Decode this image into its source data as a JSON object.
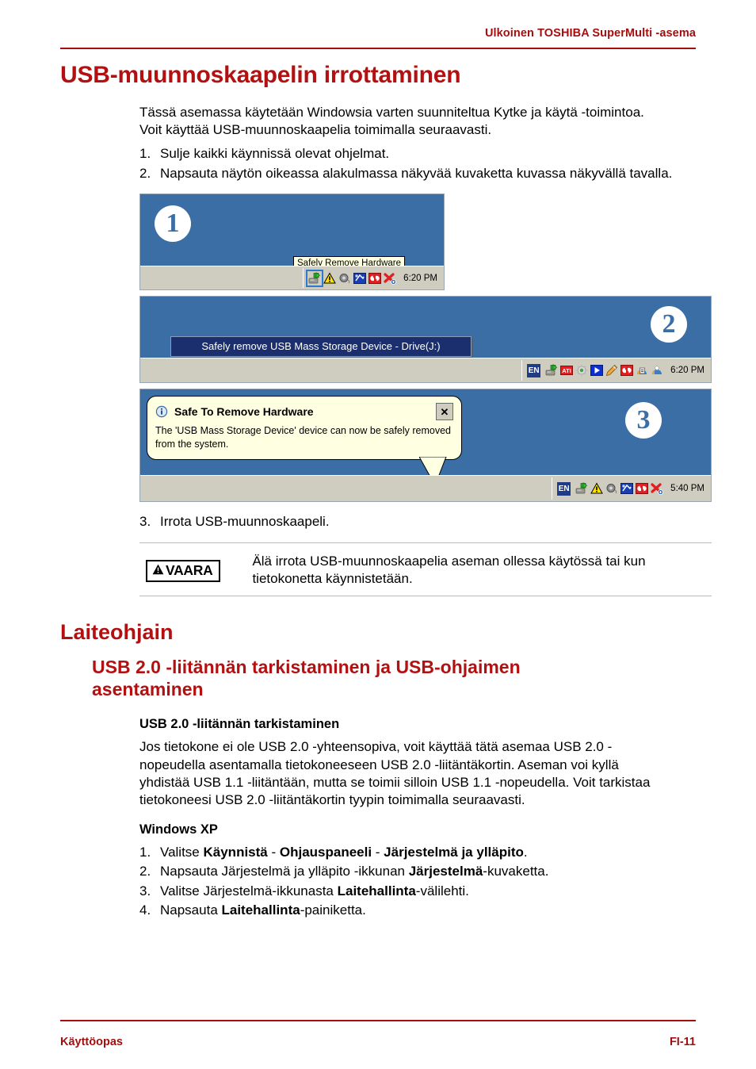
{
  "header": {
    "title": "Ulkoinen TOSHIBA SuperMulti -asema"
  },
  "footer": {
    "left": "Käyttöopas",
    "right": "FI-11"
  },
  "colors": {
    "accent_red": "#b31111",
    "header_red": "#a50e0e",
    "desktop_blue": "#3a6ea5",
    "taskbar_grey": "#cfccc0",
    "tooltip_yellow": "#ffffe1",
    "tooltip_blue": "#1b2f6e",
    "selection_blue": "#2e7ad1"
  },
  "section1": {
    "heading": "USB-muunnoskaapelin irrottaminen",
    "intro": "Tässä asemassa käytetään Windowsia varten suunniteltua Kytke ja käytä -toimintoa. Voit käyttää USB-muunnoskaapelia toimimalla seuraavasti.",
    "steps": [
      {
        "num": "1.",
        "text": "Sulje kaikki käynnissä olevat ohjelmat."
      },
      {
        "num": "2.",
        "text": "Napsauta näytön oikeassa alakulmassa näkyvää kuvaketta kuvassa näkyvällä tavalla."
      }
    ],
    "step3": {
      "num": "3.",
      "text": "Irrota USB-muunnoskaapeli."
    }
  },
  "figures": {
    "panel1": {
      "badge": "1",
      "tooltip": "Safely Remove Hardware",
      "time": "6:20 PM",
      "tray_icons": [
        "safely-remove-hardware-icon",
        "warning-icon",
        "volume-icon",
        "network-icon",
        "antivirus-icon",
        "disconnected-network-icon"
      ]
    },
    "panel2": {
      "badge": "2",
      "tooltip": "Safely remove USB Mass Storage Device - Drive(J:)",
      "language": "EN",
      "time": "6:20 PM",
      "tray_icons": [
        "safely-remove-hardware-icon",
        "ati-icon",
        "gear-icon",
        "media-player-icon",
        "pencil-icon",
        "antivirus-icon",
        "printer-icon",
        "windows-update-icon"
      ]
    },
    "panel3": {
      "badge": "3",
      "balloon_title": "Safe To Remove Hardware",
      "balloon_body": "The 'USB Mass Storage Device' device can now be safely removed from the system.",
      "balloon_close": "✕",
      "language": "EN",
      "time": "5:40 PM",
      "tray_icons": [
        "safely-remove-hardware-icon",
        "warning-icon",
        "volume-icon",
        "network-icon",
        "antivirus-icon",
        "disconnected-network-icon"
      ]
    }
  },
  "warning": {
    "badge": "VAARA",
    "text": "Älä irrota USB-muunnoskaapelia aseman ollessa käytössä tai kun tietokonetta käynnistetään."
  },
  "section2": {
    "heading": "Laiteohjain",
    "subheading": "USB 2.0 -liitännän tarkistaminen ja USB-ohjaimen asentaminen",
    "sub_subheading": "USB 2.0 -liitännän tarkistaminen",
    "paragraph": "Jos tietokone ei ole USB 2.0 -yhteensopiva, voit käyttää tätä asemaa USB 2.0 -nopeudella asentamalla tietokoneeseen USB 2.0 -liitäntäkortin. Aseman voi kyllä yhdistää USB 1.1 -liitäntään, mutta se toimii silloin USB 1.1 -nopeudella. Voit tarkistaa tietokoneesi USB 2.0 -liitäntäkortin tyypin toimimalla seuraavasti.",
    "os_heading": "Windows XP",
    "steps": [
      {
        "num": "1.",
        "parts": [
          {
            "t": "Valitse ",
            "b": false
          },
          {
            "t": "Käynnistä",
            "b": true
          },
          {
            "t": " - ",
            "b": false
          },
          {
            "t": "Ohjauspaneeli",
            "b": true
          },
          {
            "t": " - ",
            "b": false
          },
          {
            "t": "Järjestelmä ja ylläpito",
            "b": true
          },
          {
            "t": ".",
            "b": false
          }
        ]
      },
      {
        "num": "2.",
        "parts": [
          {
            "t": "Napsauta Järjestelmä ja ylläpito -ikkunan ",
            "b": false
          },
          {
            "t": "Järjestelmä",
            "b": true
          },
          {
            "t": "-kuvaketta.",
            "b": false
          }
        ]
      },
      {
        "num": "3.",
        "parts": [
          {
            "t": "Valitse Järjestelmä-ikkunasta ",
            "b": false
          },
          {
            "t": "Laitehallinta",
            "b": true
          },
          {
            "t": "-välilehti.",
            "b": false
          }
        ]
      },
      {
        "num": "4.",
        "parts": [
          {
            "t": "Napsauta ",
            "b": false
          },
          {
            "t": "Laitehallinta",
            "b": true
          },
          {
            "t": "-painiketta.",
            "b": false
          }
        ]
      }
    ]
  }
}
